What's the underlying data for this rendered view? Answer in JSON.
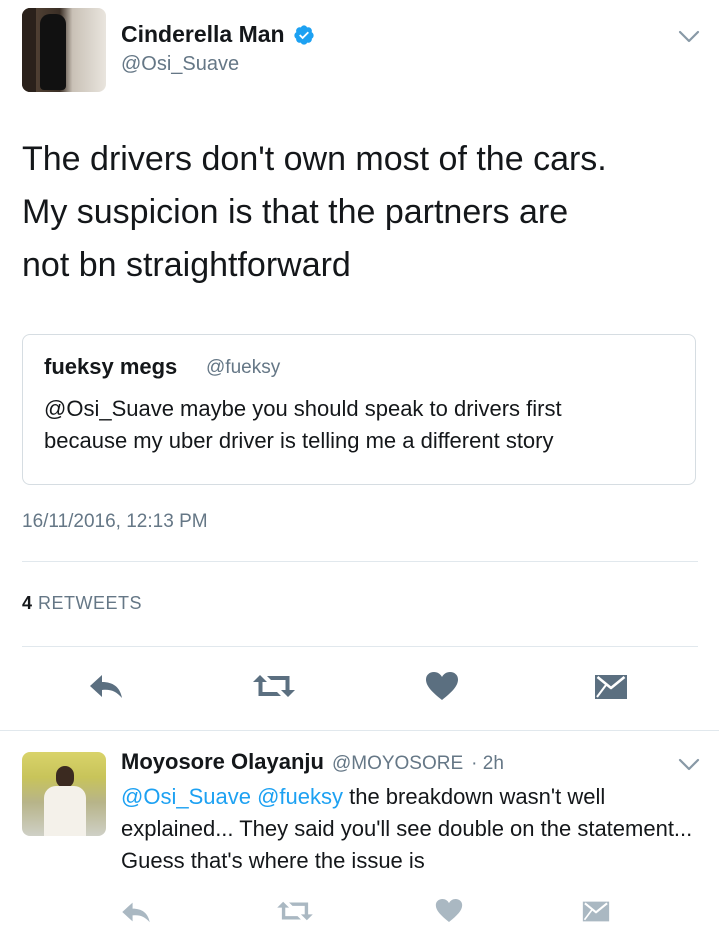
{
  "tweet": {
    "author_name": "Cinderella Man",
    "author_handle": "@Osi_Suave",
    "text": "The drivers don't own most of the cars.\nMy suspicion is that the partners are\nnot bn straightforward",
    "timestamp": "16/11/2016, 12:13 PM",
    "retweet_count": "4",
    "retweet_label": "RETWEETS"
  },
  "quote": {
    "author_name": "fueksy megs",
    "author_handle": "@fueksy",
    "text": "@Osi_Suave maybe you should speak to drivers first\nbecause my uber driver is telling me a different story"
  },
  "reply": {
    "author_name": "Moyosore Olayanju",
    "author_handle": "@MOYOSORE",
    "time": "· 2h",
    "mention1": "@Osi_Suave",
    "mention2": "@fueksy",
    "text": " the breakdown wasn't well explained... They said you'll see double on the statement... Guess that's where the issue is"
  },
  "colors": {
    "verified": "#1da1f2",
    "mention": "#1da1f2",
    "icon_main": "#5b6f80",
    "icon_reply": "#aab8c2",
    "secondary_text": "#657786"
  },
  "icons": [
    "verified-icon",
    "chevron-down-icon",
    "reply-icon",
    "retweet-icon",
    "like-icon",
    "message-icon"
  ]
}
